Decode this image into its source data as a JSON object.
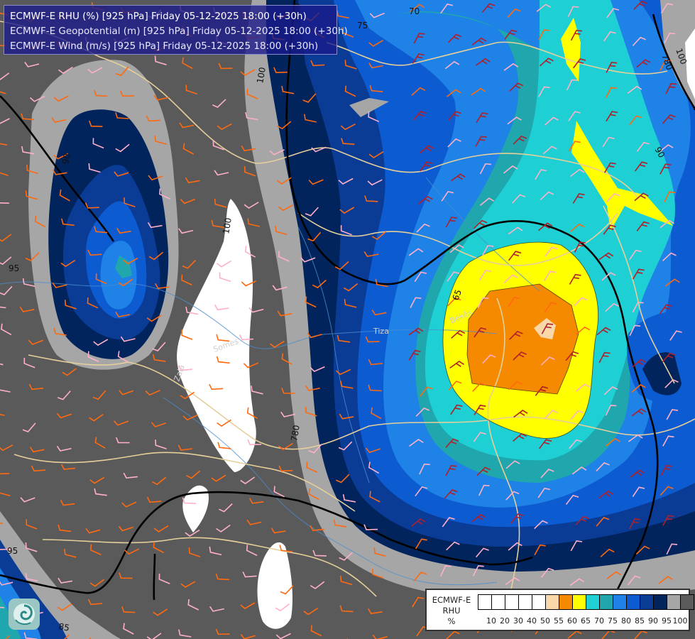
{
  "header": {
    "line1": "ECMWF-E RHU (%) [925 hPa] Friday 05-12-2025 18:00 (+30h)",
    "line2": "ECMWF-E Geopotential (m) [925 hPa] Friday 05-12-2025 18:00 (+30h)",
    "line3": "ECMWF-E Wind (m/s) [925 hPa] Friday 05-12-2025 18:00 (+30h)"
  },
  "legend": {
    "title_model": "ECMWF-E",
    "title_param": "RHU",
    "title_unit": "%",
    "ticks": [
      "10",
      "20",
      "30",
      "40",
      "50",
      "55",
      "60",
      "65",
      "70",
      "75",
      "80",
      "85",
      "90",
      "95",
      "100"
    ],
    "colors": [
      "#ffffff",
      "#ffffff",
      "#ffffff",
      "#ffffff",
      "#ffffff",
      "#f8d8a8",
      "#f58a00",
      "#ffff00",
      "#1ecfd4",
      "#20a7ae",
      "#1e82e6",
      "#0d5bd0",
      "#0a3c96",
      "#02245c",
      "#a6a6a6",
      "#5a5a5a"
    ]
  },
  "map": {
    "contour_labels": [
      "70",
      "75",
      "780",
      "100",
      "90",
      "100",
      "95",
      "90",
      "100",
      "65",
      "780",
      "780",
      "85",
      "95"
    ],
    "place_labels": [
      "Békés",
      "Somes",
      "Zala",
      "Tiza"
    ]
  }
}
